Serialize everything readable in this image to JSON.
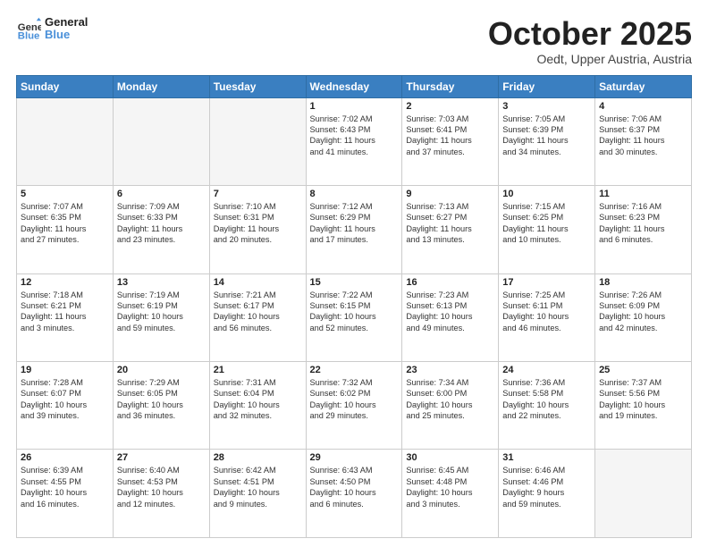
{
  "header": {
    "logo_line1": "General",
    "logo_line2": "Blue",
    "month": "October 2025",
    "location": "Oedt, Upper Austria, Austria"
  },
  "weekdays": [
    "Sunday",
    "Monday",
    "Tuesday",
    "Wednesday",
    "Thursday",
    "Friday",
    "Saturday"
  ],
  "weeks": [
    [
      {
        "day": "",
        "info": ""
      },
      {
        "day": "",
        "info": ""
      },
      {
        "day": "",
        "info": ""
      },
      {
        "day": "1",
        "info": "Sunrise: 7:02 AM\nSunset: 6:43 PM\nDaylight: 11 hours\nand 41 minutes."
      },
      {
        "day": "2",
        "info": "Sunrise: 7:03 AM\nSunset: 6:41 PM\nDaylight: 11 hours\nand 37 minutes."
      },
      {
        "day": "3",
        "info": "Sunrise: 7:05 AM\nSunset: 6:39 PM\nDaylight: 11 hours\nand 34 minutes."
      },
      {
        "day": "4",
        "info": "Sunrise: 7:06 AM\nSunset: 6:37 PM\nDaylight: 11 hours\nand 30 minutes."
      }
    ],
    [
      {
        "day": "5",
        "info": "Sunrise: 7:07 AM\nSunset: 6:35 PM\nDaylight: 11 hours\nand 27 minutes."
      },
      {
        "day": "6",
        "info": "Sunrise: 7:09 AM\nSunset: 6:33 PM\nDaylight: 11 hours\nand 23 minutes."
      },
      {
        "day": "7",
        "info": "Sunrise: 7:10 AM\nSunset: 6:31 PM\nDaylight: 11 hours\nand 20 minutes."
      },
      {
        "day": "8",
        "info": "Sunrise: 7:12 AM\nSunset: 6:29 PM\nDaylight: 11 hours\nand 17 minutes."
      },
      {
        "day": "9",
        "info": "Sunrise: 7:13 AM\nSunset: 6:27 PM\nDaylight: 11 hours\nand 13 minutes."
      },
      {
        "day": "10",
        "info": "Sunrise: 7:15 AM\nSunset: 6:25 PM\nDaylight: 11 hours\nand 10 minutes."
      },
      {
        "day": "11",
        "info": "Sunrise: 7:16 AM\nSunset: 6:23 PM\nDaylight: 11 hours\nand 6 minutes."
      }
    ],
    [
      {
        "day": "12",
        "info": "Sunrise: 7:18 AM\nSunset: 6:21 PM\nDaylight: 11 hours\nand 3 minutes."
      },
      {
        "day": "13",
        "info": "Sunrise: 7:19 AM\nSunset: 6:19 PM\nDaylight: 10 hours\nand 59 minutes."
      },
      {
        "day": "14",
        "info": "Sunrise: 7:21 AM\nSunset: 6:17 PM\nDaylight: 10 hours\nand 56 minutes."
      },
      {
        "day": "15",
        "info": "Sunrise: 7:22 AM\nSunset: 6:15 PM\nDaylight: 10 hours\nand 52 minutes."
      },
      {
        "day": "16",
        "info": "Sunrise: 7:23 AM\nSunset: 6:13 PM\nDaylight: 10 hours\nand 49 minutes."
      },
      {
        "day": "17",
        "info": "Sunrise: 7:25 AM\nSunset: 6:11 PM\nDaylight: 10 hours\nand 46 minutes."
      },
      {
        "day": "18",
        "info": "Sunrise: 7:26 AM\nSunset: 6:09 PM\nDaylight: 10 hours\nand 42 minutes."
      }
    ],
    [
      {
        "day": "19",
        "info": "Sunrise: 7:28 AM\nSunset: 6:07 PM\nDaylight: 10 hours\nand 39 minutes."
      },
      {
        "day": "20",
        "info": "Sunrise: 7:29 AM\nSunset: 6:05 PM\nDaylight: 10 hours\nand 36 minutes."
      },
      {
        "day": "21",
        "info": "Sunrise: 7:31 AM\nSunset: 6:04 PM\nDaylight: 10 hours\nand 32 minutes."
      },
      {
        "day": "22",
        "info": "Sunrise: 7:32 AM\nSunset: 6:02 PM\nDaylight: 10 hours\nand 29 minutes."
      },
      {
        "day": "23",
        "info": "Sunrise: 7:34 AM\nSunset: 6:00 PM\nDaylight: 10 hours\nand 25 minutes."
      },
      {
        "day": "24",
        "info": "Sunrise: 7:36 AM\nSunset: 5:58 PM\nDaylight: 10 hours\nand 22 minutes."
      },
      {
        "day": "25",
        "info": "Sunrise: 7:37 AM\nSunset: 5:56 PM\nDaylight: 10 hours\nand 19 minutes."
      }
    ],
    [
      {
        "day": "26",
        "info": "Sunrise: 6:39 AM\nSunset: 4:55 PM\nDaylight: 10 hours\nand 16 minutes."
      },
      {
        "day": "27",
        "info": "Sunrise: 6:40 AM\nSunset: 4:53 PM\nDaylight: 10 hours\nand 12 minutes."
      },
      {
        "day": "28",
        "info": "Sunrise: 6:42 AM\nSunset: 4:51 PM\nDaylight: 10 hours\nand 9 minutes."
      },
      {
        "day": "29",
        "info": "Sunrise: 6:43 AM\nSunset: 4:50 PM\nDaylight: 10 hours\nand 6 minutes."
      },
      {
        "day": "30",
        "info": "Sunrise: 6:45 AM\nSunset: 4:48 PM\nDaylight: 10 hours\nand 3 minutes."
      },
      {
        "day": "31",
        "info": "Sunrise: 6:46 AM\nSunset: 4:46 PM\nDaylight: 9 hours\nand 59 minutes."
      },
      {
        "day": "",
        "info": ""
      }
    ]
  ]
}
